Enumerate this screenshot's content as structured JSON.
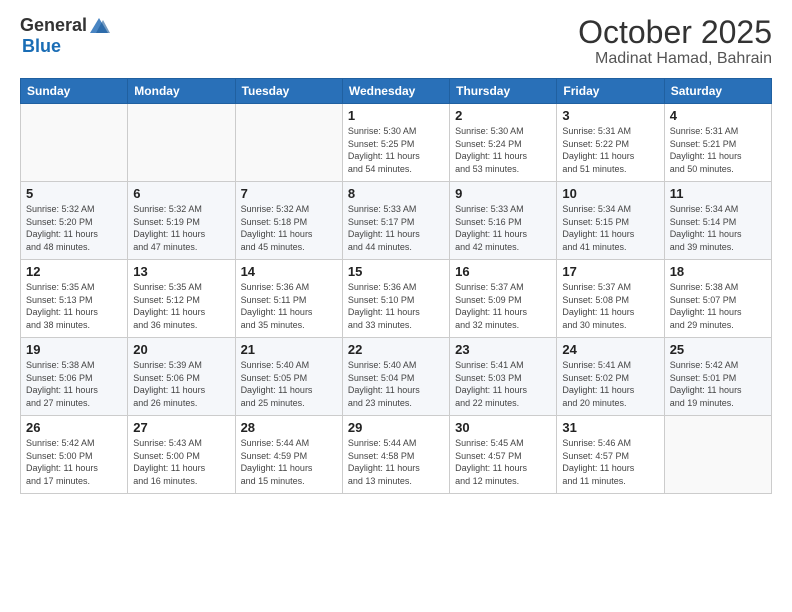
{
  "header": {
    "logo_general": "General",
    "logo_blue": "Blue",
    "month_title": "October 2025",
    "location": "Madinat Hamad, Bahrain"
  },
  "days_of_week": [
    "Sunday",
    "Monday",
    "Tuesday",
    "Wednesday",
    "Thursday",
    "Friday",
    "Saturday"
  ],
  "weeks": [
    [
      {
        "day": "",
        "info": ""
      },
      {
        "day": "",
        "info": ""
      },
      {
        "day": "",
        "info": ""
      },
      {
        "day": "1",
        "info": "Sunrise: 5:30 AM\nSunset: 5:25 PM\nDaylight: 11 hours\nand 54 minutes."
      },
      {
        "day": "2",
        "info": "Sunrise: 5:30 AM\nSunset: 5:24 PM\nDaylight: 11 hours\nand 53 minutes."
      },
      {
        "day": "3",
        "info": "Sunrise: 5:31 AM\nSunset: 5:22 PM\nDaylight: 11 hours\nand 51 minutes."
      },
      {
        "day": "4",
        "info": "Sunrise: 5:31 AM\nSunset: 5:21 PM\nDaylight: 11 hours\nand 50 minutes."
      }
    ],
    [
      {
        "day": "5",
        "info": "Sunrise: 5:32 AM\nSunset: 5:20 PM\nDaylight: 11 hours\nand 48 minutes."
      },
      {
        "day": "6",
        "info": "Sunrise: 5:32 AM\nSunset: 5:19 PM\nDaylight: 11 hours\nand 47 minutes."
      },
      {
        "day": "7",
        "info": "Sunrise: 5:32 AM\nSunset: 5:18 PM\nDaylight: 11 hours\nand 45 minutes."
      },
      {
        "day": "8",
        "info": "Sunrise: 5:33 AM\nSunset: 5:17 PM\nDaylight: 11 hours\nand 44 minutes."
      },
      {
        "day": "9",
        "info": "Sunrise: 5:33 AM\nSunset: 5:16 PM\nDaylight: 11 hours\nand 42 minutes."
      },
      {
        "day": "10",
        "info": "Sunrise: 5:34 AM\nSunset: 5:15 PM\nDaylight: 11 hours\nand 41 minutes."
      },
      {
        "day": "11",
        "info": "Sunrise: 5:34 AM\nSunset: 5:14 PM\nDaylight: 11 hours\nand 39 minutes."
      }
    ],
    [
      {
        "day": "12",
        "info": "Sunrise: 5:35 AM\nSunset: 5:13 PM\nDaylight: 11 hours\nand 38 minutes."
      },
      {
        "day": "13",
        "info": "Sunrise: 5:35 AM\nSunset: 5:12 PM\nDaylight: 11 hours\nand 36 minutes."
      },
      {
        "day": "14",
        "info": "Sunrise: 5:36 AM\nSunset: 5:11 PM\nDaylight: 11 hours\nand 35 minutes."
      },
      {
        "day": "15",
        "info": "Sunrise: 5:36 AM\nSunset: 5:10 PM\nDaylight: 11 hours\nand 33 minutes."
      },
      {
        "day": "16",
        "info": "Sunrise: 5:37 AM\nSunset: 5:09 PM\nDaylight: 11 hours\nand 32 minutes."
      },
      {
        "day": "17",
        "info": "Sunrise: 5:37 AM\nSunset: 5:08 PM\nDaylight: 11 hours\nand 30 minutes."
      },
      {
        "day": "18",
        "info": "Sunrise: 5:38 AM\nSunset: 5:07 PM\nDaylight: 11 hours\nand 29 minutes."
      }
    ],
    [
      {
        "day": "19",
        "info": "Sunrise: 5:38 AM\nSunset: 5:06 PM\nDaylight: 11 hours\nand 27 minutes."
      },
      {
        "day": "20",
        "info": "Sunrise: 5:39 AM\nSunset: 5:06 PM\nDaylight: 11 hours\nand 26 minutes."
      },
      {
        "day": "21",
        "info": "Sunrise: 5:40 AM\nSunset: 5:05 PM\nDaylight: 11 hours\nand 25 minutes."
      },
      {
        "day": "22",
        "info": "Sunrise: 5:40 AM\nSunset: 5:04 PM\nDaylight: 11 hours\nand 23 minutes."
      },
      {
        "day": "23",
        "info": "Sunrise: 5:41 AM\nSunset: 5:03 PM\nDaylight: 11 hours\nand 22 minutes."
      },
      {
        "day": "24",
        "info": "Sunrise: 5:41 AM\nSunset: 5:02 PM\nDaylight: 11 hours\nand 20 minutes."
      },
      {
        "day": "25",
        "info": "Sunrise: 5:42 AM\nSunset: 5:01 PM\nDaylight: 11 hours\nand 19 minutes."
      }
    ],
    [
      {
        "day": "26",
        "info": "Sunrise: 5:42 AM\nSunset: 5:00 PM\nDaylight: 11 hours\nand 17 minutes."
      },
      {
        "day": "27",
        "info": "Sunrise: 5:43 AM\nSunset: 5:00 PM\nDaylight: 11 hours\nand 16 minutes."
      },
      {
        "day": "28",
        "info": "Sunrise: 5:44 AM\nSunset: 4:59 PM\nDaylight: 11 hours\nand 15 minutes."
      },
      {
        "day": "29",
        "info": "Sunrise: 5:44 AM\nSunset: 4:58 PM\nDaylight: 11 hours\nand 13 minutes."
      },
      {
        "day": "30",
        "info": "Sunrise: 5:45 AM\nSunset: 4:57 PM\nDaylight: 11 hours\nand 12 minutes."
      },
      {
        "day": "31",
        "info": "Sunrise: 5:46 AM\nSunset: 4:57 PM\nDaylight: 11 hours\nand 11 minutes."
      },
      {
        "day": "",
        "info": ""
      }
    ]
  ]
}
